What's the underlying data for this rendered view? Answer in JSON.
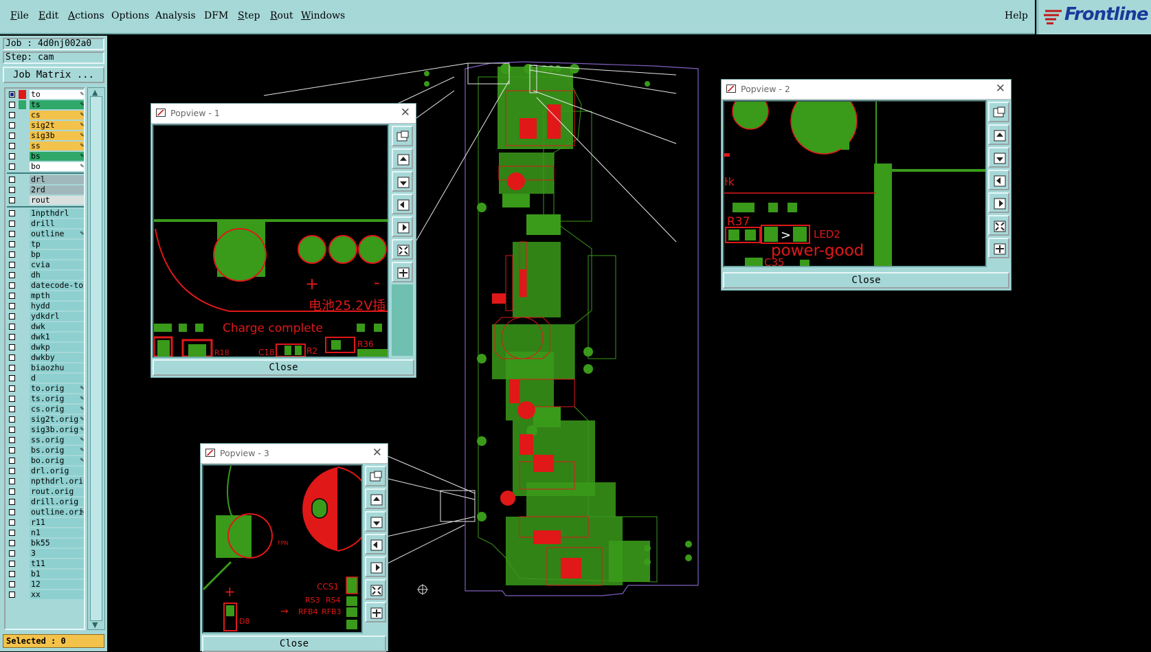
{
  "menubar": {
    "file": "File",
    "edit": "Edit",
    "actions": "Actions",
    "options": "Options",
    "analysis": "Analysis",
    "dfm": "DFM",
    "step": "Step",
    "rout": "Rout",
    "windows": "Windows",
    "help": "Help"
  },
  "logo": {
    "text": "Frontline",
    "color": "#1a3a9a"
  },
  "job": {
    "job_label": "Job : 4d0nj002a0",
    "step_label": "Step: cam",
    "matrix_button": "Job Matrix ..."
  },
  "layers": [
    {
      "name": "to",
      "color": "#ffffff",
      "swatch": "#e01818",
      "checked": true,
      "pen": true
    },
    {
      "name": "ts",
      "color": "#2fa86a",
      "swatch": "#2fa86a",
      "checked": false,
      "pen": true
    },
    {
      "name": "cs",
      "color": "#f3c24a",
      "swatch": "#a7d8d8",
      "checked": false,
      "pen": true
    },
    {
      "name": "sig2t",
      "color": "#f3c24a",
      "swatch": "#a7d8d8",
      "checked": false,
      "pen": true
    },
    {
      "name": "sig3b",
      "color": "#f3c24a",
      "swatch": "#a7d8d8",
      "checked": false,
      "pen": true
    },
    {
      "name": "ss",
      "color": "#f3c24a",
      "swatch": "#a7d8d8",
      "checked": false,
      "pen": true
    },
    {
      "name": "bs",
      "color": "#2fa86a",
      "swatch": "#a7d8d8",
      "checked": false,
      "pen": true
    },
    {
      "name": "bo",
      "color": "#ffffff",
      "swatch": "#a7d8d8",
      "checked": false,
      "pen": true
    },
    {
      "name": "drl",
      "color": "#a0b8bc",
      "swatch": "#a7d8d8",
      "checked": false,
      "pen": false
    },
    {
      "name": "2rd",
      "color": "#a0b8bc",
      "swatch": "#a7d8d8",
      "checked": false,
      "pen": false
    },
    {
      "name": "rout",
      "color": "#d8e0e0",
      "swatch": "#a7d8d8",
      "checked": false,
      "pen": false
    },
    {
      "name": "1npthdrl",
      "color": "#8ed0d0",
      "swatch": "#a7d8d8",
      "checked": false,
      "pen": false
    },
    {
      "name": "drill",
      "color": "#8ed0d0",
      "swatch": "#a7d8d8",
      "checked": false,
      "pen": false
    },
    {
      "name": "outline",
      "color": "#8ed0d0",
      "swatch": "#a7d8d8",
      "checked": false,
      "pen": true
    },
    {
      "name": "tp",
      "color": "#8ed0d0",
      "swatch": "#a7d8d8",
      "checked": false,
      "pen": false
    },
    {
      "name": "bp",
      "color": "#8ed0d0",
      "swatch": "#a7d8d8",
      "checked": false,
      "pen": false
    },
    {
      "name": "cvia",
      "color": "#8ed0d0",
      "swatch": "#a7d8d8",
      "checked": false,
      "pen": false
    },
    {
      "name": "dh",
      "color": "#8ed0d0",
      "swatch": "#a7d8d8",
      "checked": false,
      "pen": false
    },
    {
      "name": "datecode-to",
      "color": "#8ed0d0",
      "swatch": "#a7d8d8",
      "checked": false,
      "pen": false
    },
    {
      "name": "mpth",
      "color": "#8ed0d0",
      "swatch": "#a7d8d8",
      "checked": false,
      "pen": false
    },
    {
      "name": "hydd",
      "color": "#8ed0d0",
      "swatch": "#a7d8d8",
      "checked": false,
      "pen": false
    },
    {
      "name": "ydkdrl",
      "color": "#8ed0d0",
      "swatch": "#a7d8d8",
      "checked": false,
      "pen": false
    },
    {
      "name": "dwk",
      "color": "#8ed0d0",
      "swatch": "#a7d8d8",
      "checked": false,
      "pen": false
    },
    {
      "name": "dwk1",
      "color": "#8ed0d0",
      "swatch": "#a7d8d8",
      "checked": false,
      "pen": false
    },
    {
      "name": "dwkp",
      "color": "#8ed0d0",
      "swatch": "#a7d8d8",
      "checked": false,
      "pen": false
    },
    {
      "name": "dwkby",
      "color": "#8ed0d0",
      "swatch": "#a7d8d8",
      "checked": false,
      "pen": false
    },
    {
      "name": "biaozhu",
      "color": "#8ed0d0",
      "swatch": "#a7d8d8",
      "checked": false,
      "pen": false
    },
    {
      "name": "d",
      "color": "#8ed0d0",
      "swatch": "#a7d8d8",
      "checked": false,
      "pen": false
    },
    {
      "name": "to.orig",
      "color": "#8ed0d0",
      "swatch": "#a7d8d8",
      "checked": false,
      "pen": true
    },
    {
      "name": "ts.orig",
      "color": "#8ed0d0",
      "swatch": "#a7d8d8",
      "checked": false,
      "pen": true
    },
    {
      "name": "cs.orig",
      "color": "#8ed0d0",
      "swatch": "#a7d8d8",
      "checked": false,
      "pen": true
    },
    {
      "name": "sig2t.orig",
      "color": "#8ed0d0",
      "swatch": "#a7d8d8",
      "checked": false,
      "pen": true
    },
    {
      "name": "sig3b.orig",
      "color": "#8ed0d0",
      "swatch": "#a7d8d8",
      "checked": false,
      "pen": true
    },
    {
      "name": "ss.orig",
      "color": "#8ed0d0",
      "swatch": "#a7d8d8",
      "checked": false,
      "pen": true
    },
    {
      "name": "bs.orig",
      "color": "#8ed0d0",
      "swatch": "#a7d8d8",
      "checked": false,
      "pen": true
    },
    {
      "name": "bo.orig",
      "color": "#8ed0d0",
      "swatch": "#a7d8d8",
      "checked": false,
      "pen": true
    },
    {
      "name": "drl.orig",
      "color": "#8ed0d0",
      "swatch": "#a7d8d8",
      "checked": false,
      "pen": false
    },
    {
      "name": "npthdrl.orig",
      "color": "#8ed0d0",
      "swatch": "#a7d8d8",
      "checked": false,
      "pen": false
    },
    {
      "name": "rout.orig",
      "color": "#8ed0d0",
      "swatch": "#a7d8d8",
      "checked": false,
      "pen": false
    },
    {
      "name": "drill.orig",
      "color": "#8ed0d0",
      "swatch": "#a7d8d8",
      "checked": false,
      "pen": false
    },
    {
      "name": "outline.orig",
      "color": "#8ed0d0",
      "swatch": "#a7d8d8",
      "checked": false,
      "pen": true
    },
    {
      "name": "r11",
      "color": "#8ed0d0",
      "swatch": "#a7d8d8",
      "checked": false,
      "pen": false
    },
    {
      "name": "n1",
      "color": "#8ed0d0",
      "swatch": "#a7d8d8",
      "checked": false,
      "pen": false
    },
    {
      "name": "bk55",
      "color": "#8ed0d0",
      "swatch": "#a7d8d8",
      "checked": false,
      "pen": false
    },
    {
      "name": "3",
      "color": "#8ed0d0",
      "swatch": "#a7d8d8",
      "checked": false,
      "pen": false
    },
    {
      "name": "t11",
      "color": "#8ed0d0",
      "swatch": "#a7d8d8",
      "checked": false,
      "pen": false
    },
    {
      "name": "b1",
      "color": "#8ed0d0",
      "swatch": "#a7d8d8",
      "checked": false,
      "pen": false
    },
    {
      "name": "12",
      "color": "#8ed0d0",
      "swatch": "#a7d8d8",
      "checked": false,
      "pen": false
    },
    {
      "name": "xx",
      "color": "#8ed0d0",
      "swatch": "#a7d8d8",
      "checked": false,
      "pen": false
    }
  ],
  "status": {
    "selected": "Selected : 0"
  },
  "popview1": {
    "title": "Popview - 1",
    "close": "Close",
    "texts": {
      "charge": "Charge complete",
      "battery": "电池25.2V插",
      "r18": "R18",
      "c18": "C18",
      "r2": "R2",
      "r36": "R36",
      "plus": "+",
      "minus": "-"
    }
  },
  "popview2": {
    "title": "Popview - 2",
    "close": "Close",
    "texts": {
      "r37": "R37",
      "led2": "LED2",
      "power": "power-good",
      "c35": "C35"
    }
  },
  "popview3": {
    "title": "Popview - 3",
    "close": "Close",
    "texts": {
      "ccs1": "CCS1",
      "rs3": "RS3",
      "rs4": "RS4",
      "rfb4": "RFB4",
      "rfb3": "RFB3",
      "fpn": "FPN",
      "d8": "D8",
      "plus": "+"
    }
  },
  "colors": {
    "ui": "#a7d8d8",
    "copper": "#3a9a1a",
    "silk": "#e01818",
    "outline": "#8060c0"
  }
}
